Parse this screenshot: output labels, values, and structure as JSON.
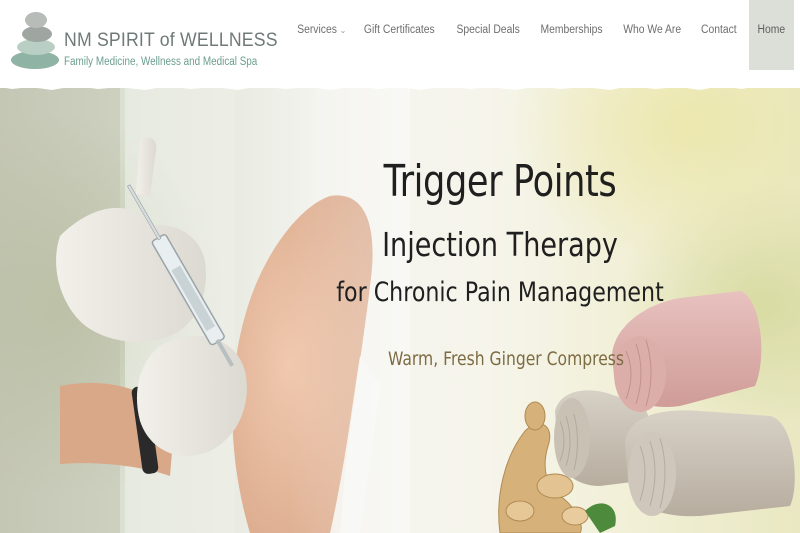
{
  "site": {
    "title": "NM SPIRIT of WELLNESS",
    "tagline": "Family Medicine, Wellness and Medical Spa"
  },
  "nav": {
    "items": [
      {
        "label": "Services",
        "has_dropdown": true
      },
      {
        "label": "Gift Certificates"
      },
      {
        "label": "Special Deals"
      },
      {
        "label": "Memberships"
      },
      {
        "label": "Who We Are"
      },
      {
        "label": "Contact"
      },
      {
        "label": "Home",
        "active": true
      }
    ]
  },
  "hero": {
    "line1": "Trigger Points",
    "line2": "Injection Therapy",
    "line3": "for Chronic Pain Management",
    "subtitle": "Warm, Fresh Ginger Compress"
  },
  "colors": {
    "logo_text": "#6f7a78",
    "tagline": "#6b9e8f",
    "nav_text": "#6e6e6e",
    "nav_active_bg": "#dcdfd8",
    "headline": "#1f1f1f",
    "subtitle": "#7d6b43"
  }
}
